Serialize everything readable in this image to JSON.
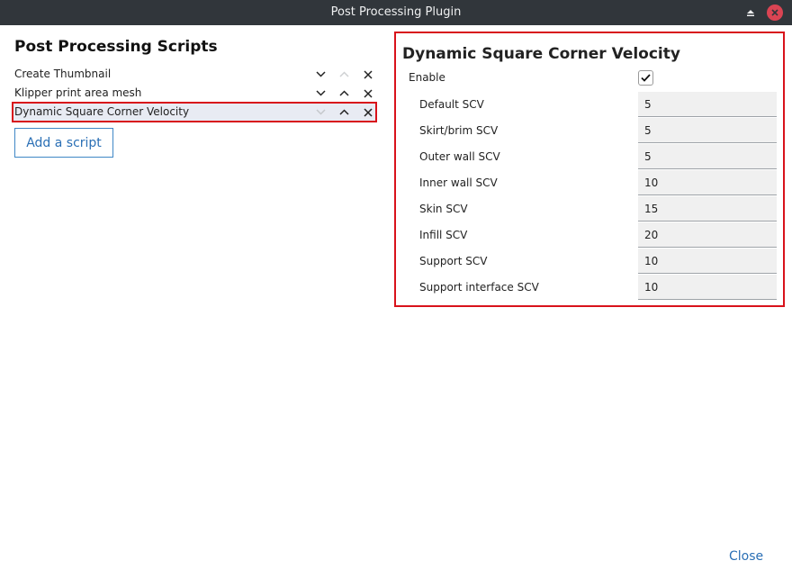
{
  "window": {
    "title": "Post Processing Plugin"
  },
  "scripts_panel": {
    "title": "Post Processing Scripts",
    "scripts": [
      {
        "label": "Create Thumbnail",
        "selected": false,
        "up_enabled": false
      },
      {
        "label": "Klipper print area mesh",
        "selected": false,
        "up_enabled": true
      },
      {
        "label": "Dynamic Square Corner Velocity",
        "selected": true,
        "up_enabled": true
      }
    ],
    "add_button": "Add a script"
  },
  "settings_panel": {
    "title": "Dynamic Square Corner Velocity",
    "enable_label": "Enable",
    "enable_checked": true,
    "settings": [
      {
        "label": "Default SCV",
        "value": "5"
      },
      {
        "label": "Skirt/brim SCV",
        "value": "5"
      },
      {
        "label": "Outer wall SCV",
        "value": "5"
      },
      {
        "label": "Inner wall SCV",
        "value": "10"
      },
      {
        "label": "Skin SCV",
        "value": "15"
      },
      {
        "label": "Infill SCV",
        "value": "20"
      },
      {
        "label": "Support SCV",
        "value": "10"
      },
      {
        "label": "Support interface SCV",
        "value": "10"
      }
    ]
  },
  "close_label": "Close",
  "colors": {
    "accent": "#2a6fb5",
    "highlight": "#d8121b",
    "titlebar": "#31363b"
  }
}
